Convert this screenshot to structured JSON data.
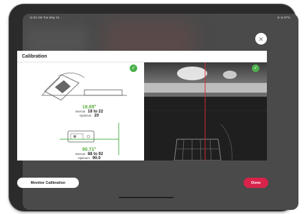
{
  "status": {
    "time_date": "11:52 AM   Tue May 16",
    "battery": "⊜ ⊜ 97%"
  },
  "dialog": {
    "title": "Calibration",
    "top_measure": {
      "angle": "18.89°",
      "interval_label": "Interval",
      "interval_value": "18 to 22",
      "optimum_label": "Optimum",
      "optimum_value": "20"
    },
    "bottom_measure": {
      "angle": "90.71°",
      "interval_label": "Interval",
      "interval_value": "88 to 92",
      "optimum_label": "Optimum",
      "optimum_value": "90.0"
    }
  },
  "buttons": {
    "monitor": "Monitor Calibration",
    "done": "Done",
    "close": "×"
  },
  "icons": {
    "close": "close-icon",
    "check": "checkmark-icon"
  },
  "colors": {
    "accent_green": "#4cb14c",
    "done_red": "#d8234a",
    "marker_red": "#e0262f"
  }
}
